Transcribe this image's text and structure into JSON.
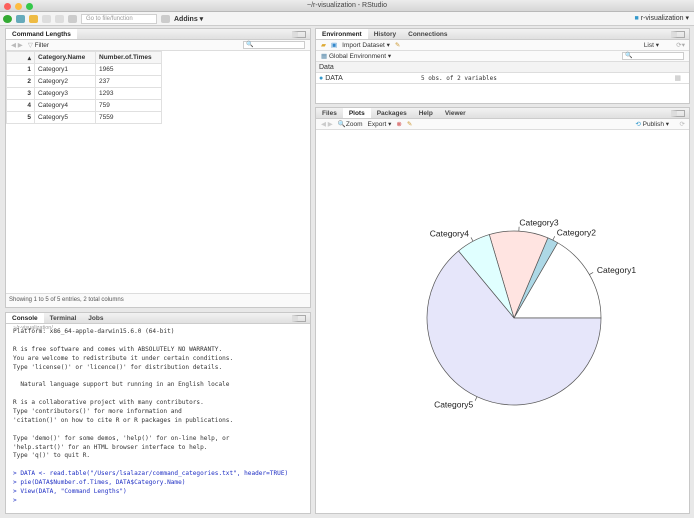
{
  "window": {
    "title": "~/r-visualization - RStudio"
  },
  "toolbar": {
    "goto_placeholder": "Go to file/function",
    "addins": "Addins ▾",
    "project": "r-visualization ▾"
  },
  "source": {
    "tab": "Command Lengths",
    "filter": "Filter",
    "columns": [
      "Category.Name",
      "Number.of.Times"
    ],
    "rows": [
      [
        "1",
        "Category1",
        "1965"
      ],
      [
        "2",
        "Category2",
        "237"
      ],
      [
        "3",
        "Category3",
        "1293"
      ],
      [
        "4",
        "Category4",
        "759"
      ],
      [
        "5",
        "Category5",
        "7559"
      ]
    ],
    "status": "Showing 1 to 5 of 5 entries, 2 total columns"
  },
  "console": {
    "tabs": [
      "Console",
      "Terminal",
      "Jobs"
    ],
    "path": "~/r-visualization/",
    "lines": [
      "Platform: x86_64-apple-darwin15.6.0 (64-bit)",
      "",
      "R is free software and comes with ABSOLUTELY NO WARRANTY.",
      "You are welcome to redistribute it under certain conditions.",
      "Type 'license()' or 'licence()' for distribution details.",
      "",
      "  Natural language support but running in an English locale",
      "",
      "R is a collaborative project with many contributors.",
      "Type 'contributors()' for more information and",
      "'citation()' on how to cite R or R packages in publications.",
      "",
      "Type 'demo()' for some demos, 'help()' for on-line help, or",
      "'help.start()' for an HTML browser interface to help.",
      "Type 'q()' to quit R.",
      ""
    ],
    "commands": [
      "> DATA <- read.table(\"/Users/lsalazar/command_categories.txt\", header=TRUE)",
      "> pie(DATA$Number.of.Times, DATA$Category.Name)",
      "> View(DATA, \"Command Lengths\")",
      "> "
    ]
  },
  "environment": {
    "tabs": [
      "Environment",
      "History",
      "Connections"
    ],
    "import": "Import Dataset ▾",
    "list": "List ▾",
    "scope": "Global Environment ▾",
    "section": "Data",
    "var_name": "DATA",
    "var_value": "5 obs. of 2 variables"
  },
  "files": {
    "tabs": [
      "Files",
      "Plots",
      "Packages",
      "Help",
      "Viewer"
    ],
    "zoom": "Zoom",
    "export": "Export ▾",
    "publish": "Publish ▾"
  },
  "chart_data": {
    "type": "pie",
    "categories": [
      "Category1",
      "Category2",
      "Category3",
      "Category4",
      "Category5"
    ],
    "values": [
      1965,
      237,
      1293,
      759,
      7559
    ],
    "colors": [
      "#ffffff",
      "#add8e6",
      "#ffe4e1",
      "#e0ffff",
      "#e6e6fa"
    ],
    "start": "3 o'clock",
    "direction": "counterclockwise"
  }
}
